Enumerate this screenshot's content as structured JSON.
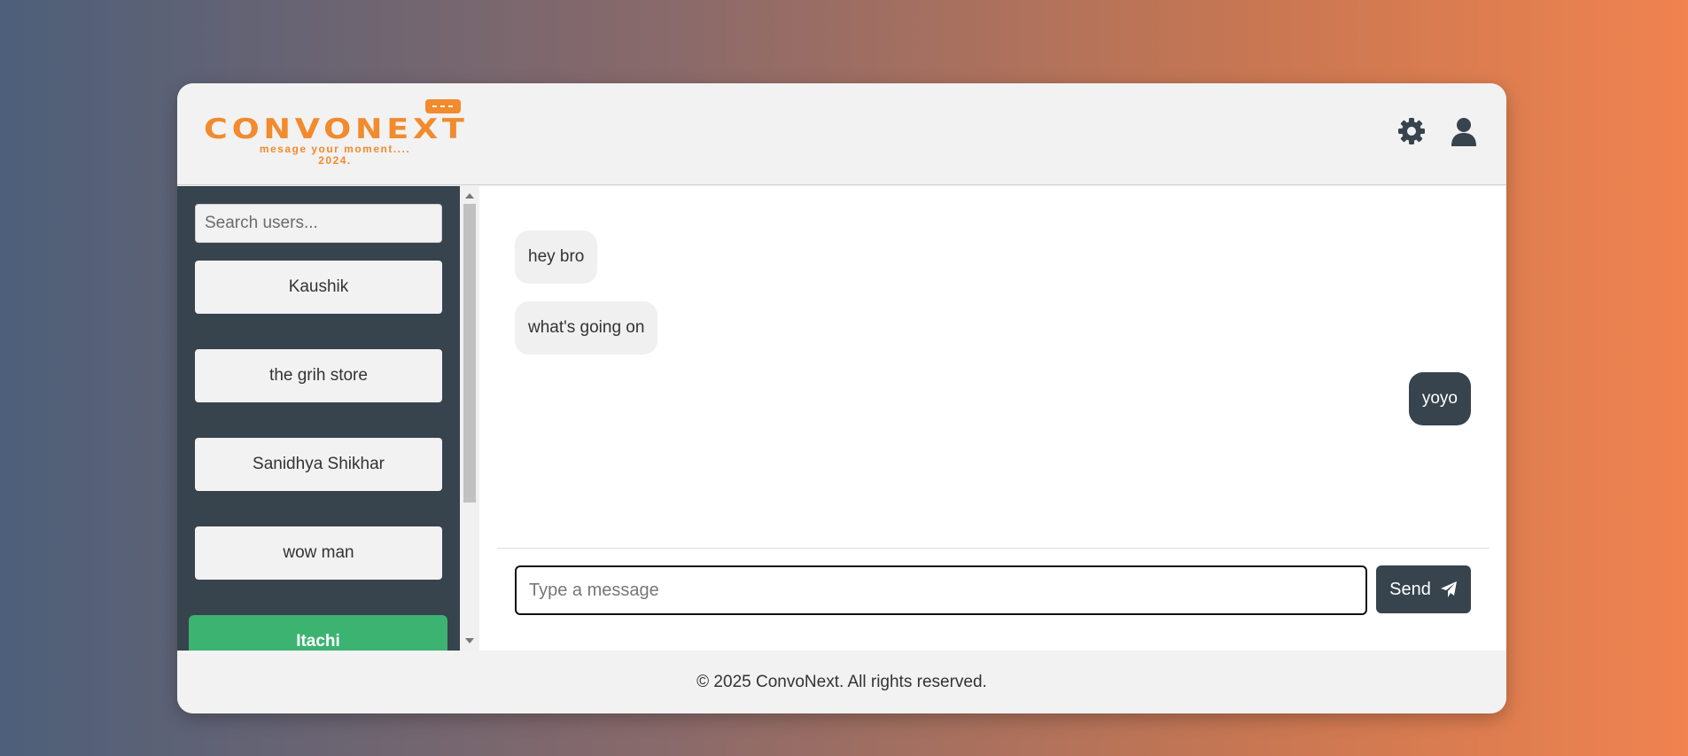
{
  "header": {
    "logo_text": "CONVONEXT",
    "logo_tagline": "mesage your moment....",
    "logo_year": "2024.",
    "settings_icon": "gear-icon",
    "profile_icon": "user-icon"
  },
  "sidebar": {
    "search_placeholder": "Search users...",
    "users": [
      {
        "label": "Kaushik"
      },
      {
        "label": "the grih store"
      },
      {
        "label": "Sanidhya Shikhar"
      },
      {
        "label": "wow man"
      },
      {
        "label": "Itachi"
      }
    ]
  },
  "chat": {
    "messages": [
      {
        "text": "hey bro",
        "direction": "incoming"
      },
      {
        "text": "what's going on",
        "direction": "incoming"
      },
      {
        "text": "yoyo",
        "direction": "outgoing"
      }
    ],
    "input_placeholder": "Type a message",
    "send_label": "Send",
    "send_icon": "paper-plane-icon"
  },
  "footer": {
    "text": "© 2025 ConvoNext. All rights reserved."
  },
  "colors": {
    "accent": "#f28a2e",
    "dark": "#37434d",
    "active_user": "#3cb371"
  }
}
